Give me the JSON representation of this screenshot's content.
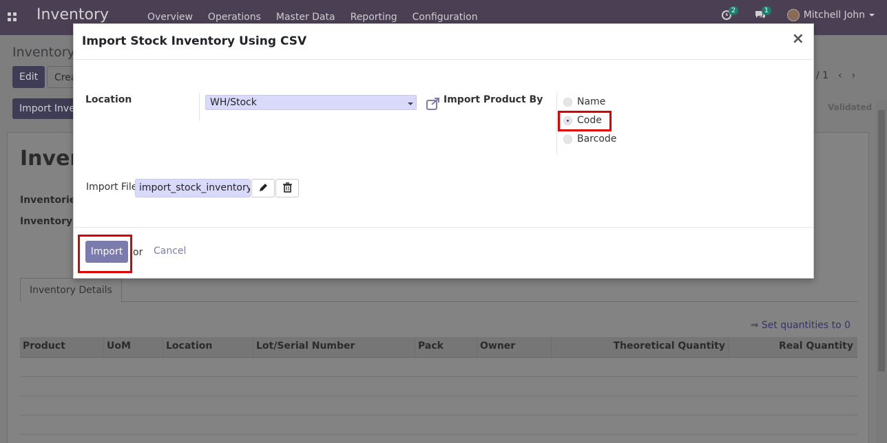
{
  "navbar": {
    "brand": "Inventory",
    "menu": [
      "Overview",
      "Operations",
      "Master Data",
      "Reporting",
      "Configuration"
    ],
    "activity_count": "2",
    "messages_count": "1",
    "user_name": "Mitchell John"
  },
  "background": {
    "breadcrumb": "Inventory",
    "edit_label": "Edit",
    "create_label": "Crea",
    "import_button_label": "Import Inven",
    "pager": "/ 1",
    "status": "Validated",
    "sheet_title": "Invent",
    "field_inventoried": "Inventoried",
    "field_inventory_of": "Inventory of",
    "tab_details": "Inventory Details",
    "set_quantities_label": "⇒ Set quantities to 0",
    "table_headers": [
      "Product",
      "UoM",
      "Location",
      "Lot/Serial Number",
      "Pack",
      "Owner",
      "Theoretical Quantity",
      "Real Quantity"
    ]
  },
  "modal": {
    "title": "Import Stock Inventory Using CSV",
    "close_glyph": "×",
    "location_label": "Location",
    "location_value": "WH/Stock",
    "import_by_label": "Import Product By",
    "import_by_options": [
      "Name",
      "Code",
      "Barcode"
    ],
    "import_by_selected": "Code",
    "file_label": "Import File",
    "file_value": "import_stock_inventory_v",
    "import_button": "Import",
    "or_text": "or",
    "cancel_link": "Cancel"
  },
  "colors": {
    "navbar": "#4b3f54",
    "primary": "#7c7bad",
    "highlight": "#e00000"
  }
}
